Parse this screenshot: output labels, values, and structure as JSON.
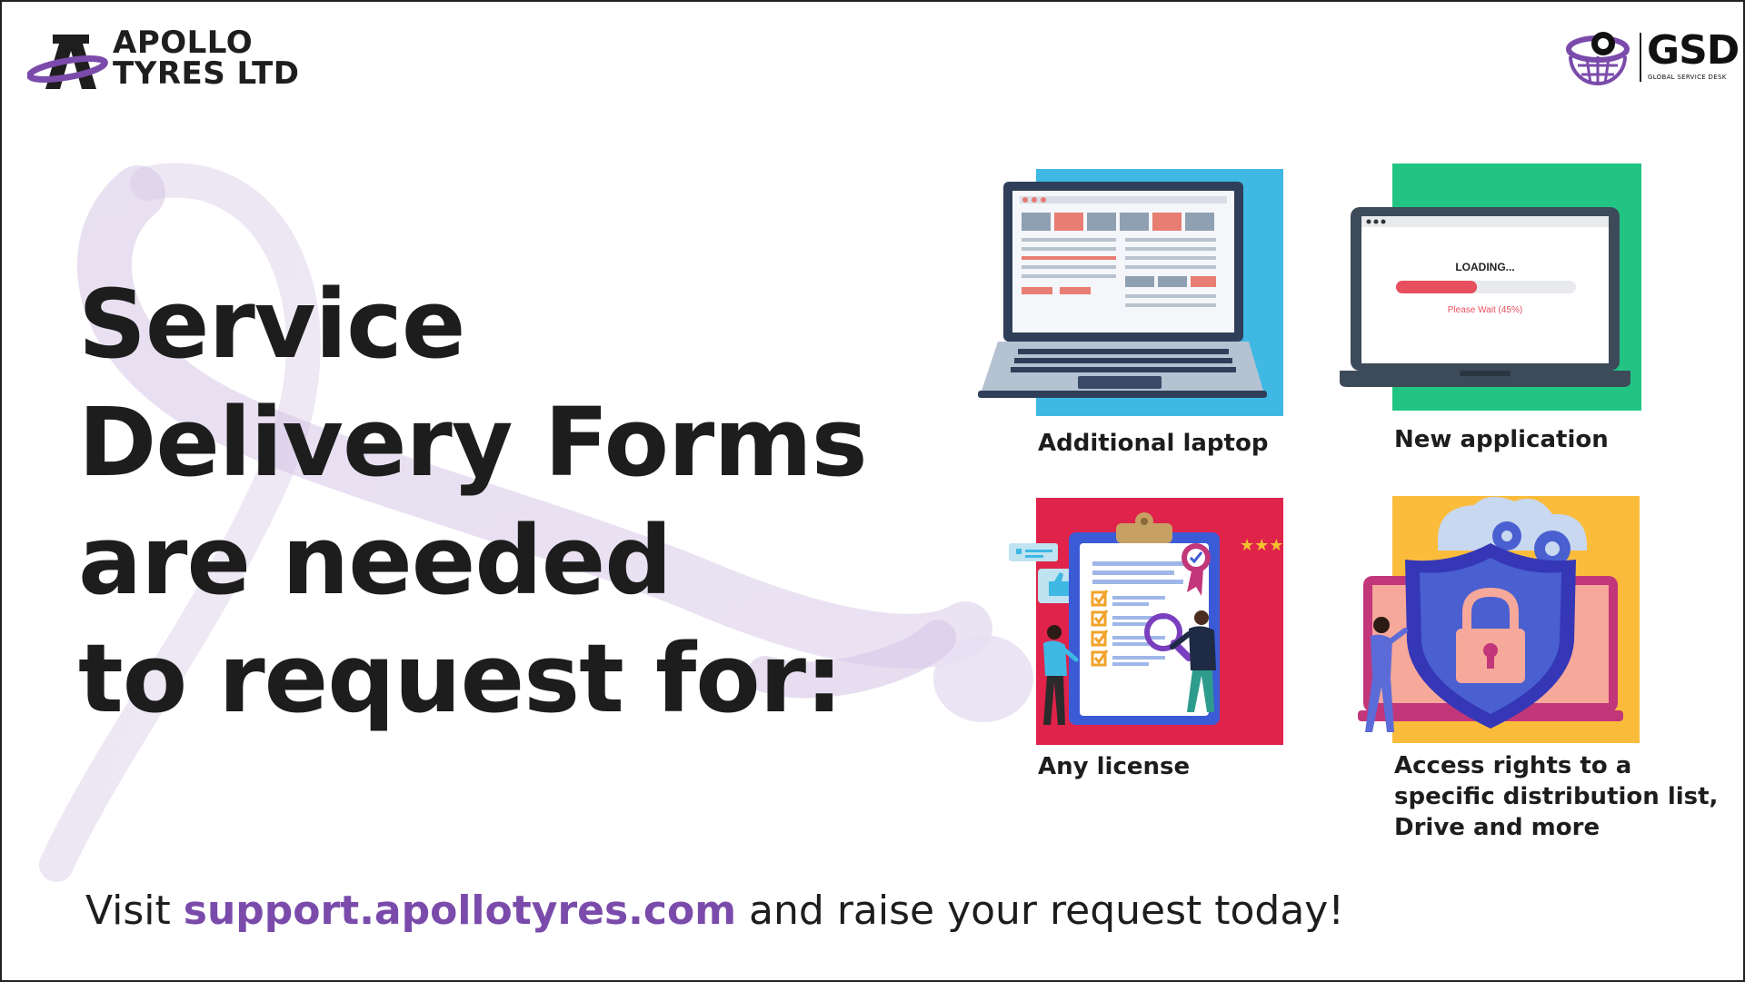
{
  "brand": {
    "company_line1": "APOLLO",
    "company_line2": "TYRES LTD",
    "gsd": "GSD",
    "gsd_sub": "GLOBAL SERVICE DESK"
  },
  "headline": {
    "line1": "Service",
    "line2": "Delivery Forms",
    "line3": "are needed",
    "line4": "to request for:"
  },
  "tiles": [
    {
      "caption": "Additional laptop",
      "color": "#3fb8e4",
      "icon": "laptop-illustration"
    },
    {
      "caption": "New application",
      "color": "#22c483",
      "icon": "loading-laptop-illustration",
      "screen_title": "LOADING...",
      "screen_status": "Please Wait (45%)",
      "progress": 0.45
    },
    {
      "caption": "Any license",
      "color": "#e0234a",
      "icon": "clipboard-checklist-illustration"
    },
    {
      "caption_line1": "Access rights to a",
      "caption_line2": "specific distribution list,",
      "caption_line3": "Drive and more",
      "color": "#fbbc3c",
      "icon": "security-shield-illustration"
    }
  ],
  "footer": {
    "prefix": "Visit ",
    "link": "support.apollotyres.com",
    "suffix": " and raise your request today!"
  },
  "colors": {
    "accent_purple": "#7a4bab",
    "text_dark": "#1d1d1d"
  }
}
